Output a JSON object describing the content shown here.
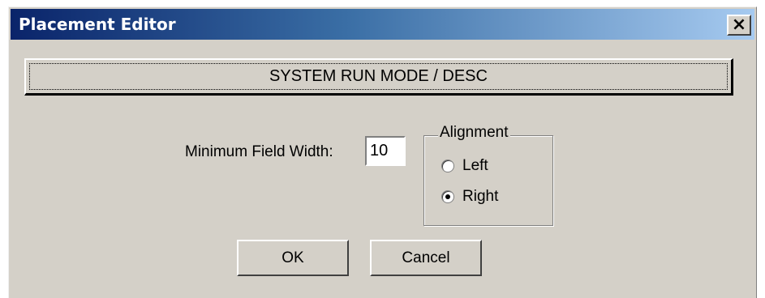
{
  "window": {
    "title": "Placement Editor",
    "close_glyph": "×"
  },
  "field": {
    "label": "SYSTEM RUN MODE / DESC"
  },
  "min_width": {
    "label": "Minimum Field Width:",
    "value": "10"
  },
  "alignment": {
    "legend": "Alignment",
    "options": [
      {
        "label": "Left",
        "selected": false
      },
      {
        "label": "Right",
        "selected": true
      }
    ]
  },
  "buttons": {
    "ok": "OK",
    "cancel": "Cancel"
  },
  "colors": {
    "face": "#d4d0c8",
    "title_gradient_start": "#0a246a",
    "title_gradient_end": "#a6caf0"
  }
}
